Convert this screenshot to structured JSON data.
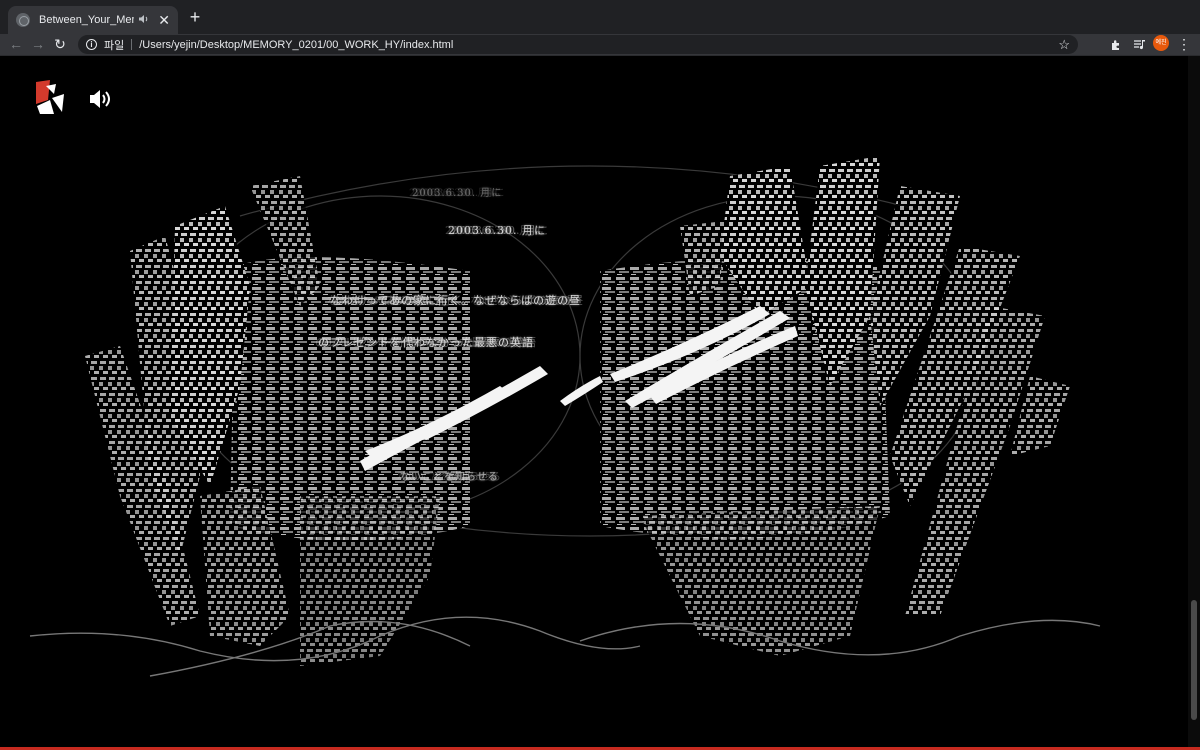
{
  "browser": {
    "tab": {
      "title": "Between_Your_Memories",
      "audio_icon": "speaker-icon",
      "close_glyph": "✕"
    },
    "new_tab_glyph": "+",
    "nav": {
      "back": "←",
      "forward": "→",
      "reload": "↻"
    },
    "omnibox": {
      "scheme_label": "파일",
      "url": "/Users/yejin/Desktop/MEMORY_0201/00_WORK_HY/index.html",
      "star_glyph": "☆"
    },
    "profile_label": "예진",
    "menu_glyph": "⋮"
  },
  "page": {
    "logo": "red-white-logo-icon",
    "sound_icon": "speaker-volume-icon",
    "artwork_texts": [
      "2003.6.30. 月に",
      "2003.6.30. 月に",
      "なわけってあの家に行く。なぜならばの遊の昼",
      "のプレゼントを代わなかった最悪の英語",
      "ないことを知らせる"
    ]
  },
  "colors": {
    "tab_strip": "#202124",
    "toolbar": "#35363a",
    "page_background": "#000000",
    "accent_red": "#c62a1f",
    "avatar": "#e8590c"
  }
}
